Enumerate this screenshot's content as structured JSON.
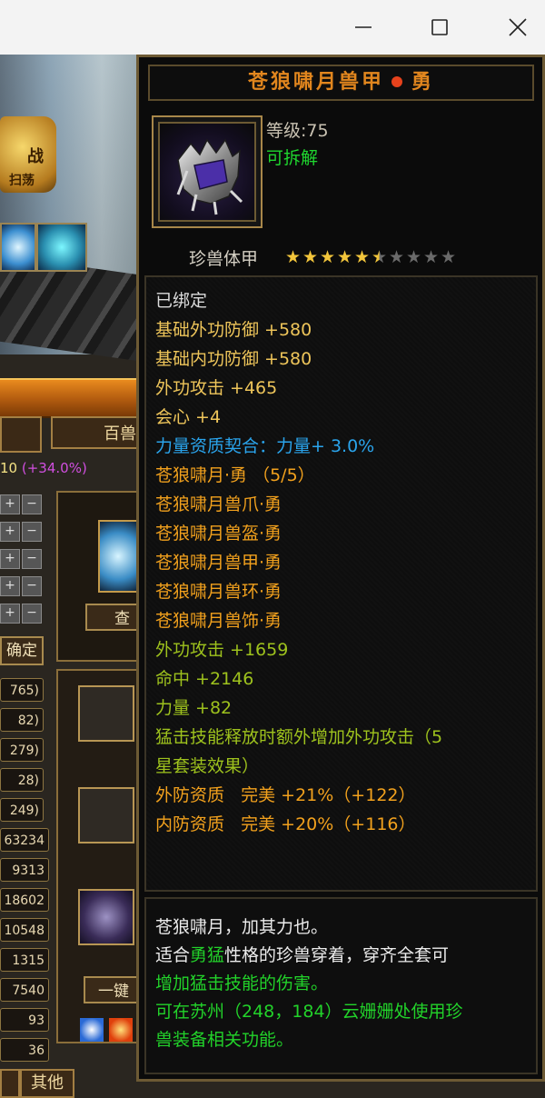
{
  "window": {
    "minimize_icon": "minimize-icon",
    "maximize_icon": "maximize-icon",
    "close_icon": "close-icon"
  },
  "game_bg": {
    "badge_text": "战",
    "badge_subtext": "扫荡",
    "tab_label": "百兽",
    "value_text": "10",
    "value_pct": "(+34.0%)",
    "confirm_label": "确定",
    "check_label": "查",
    "stat_values": [
      "765)",
      "82)",
      "279)",
      "28)",
      "249)",
      "63234",
      "9313",
      "18602",
      "10548",
      "1315",
      "7540",
      "93",
      "36"
    ],
    "onekey_label": "一键",
    "other_tab": "其他"
  },
  "tooltip": {
    "title": "苍狼啸月兽甲",
    "title_suffix": "勇",
    "level_text": "等级:75",
    "decompose_text": "可拆解",
    "item_type": "珍兽体甲",
    "star_rating": 5.5,
    "star_total": 10,
    "attributes": [
      {
        "text": "已绑定",
        "color": "white"
      },
      {
        "text": "基础外功防御 +580",
        "color": "yellow"
      },
      {
        "text": "基础内功防御 +580",
        "color": "yellow"
      },
      {
        "text": "外功攻击 +465",
        "color": "yellow"
      },
      {
        "text": "会心 +4",
        "color": "yellow"
      },
      {
        "text": "力量资质契合：力量+ 3.0%",
        "color": "blue"
      },
      {
        "text": "苍狼啸月·勇 （5/5）",
        "color": "orange"
      },
      {
        "text": "苍狼啸月兽爪·勇",
        "color": "orange"
      },
      {
        "text": "苍狼啸月兽盔·勇",
        "color": "orange"
      },
      {
        "text": "苍狼啸月兽甲·勇",
        "color": "orange"
      },
      {
        "text": "苍狼啸月兽环·勇",
        "color": "orange"
      },
      {
        "text": "苍狼啸月兽饰·勇",
        "color": "orange"
      },
      {
        "text": "外功攻击 +1659",
        "color": "green"
      },
      {
        "text": "命中 +2146",
        "color": "green"
      },
      {
        "text": "力量 +82",
        "color": "green"
      },
      {
        "text": "猛击技能释放时额外增加外功攻击（5",
        "color": "green"
      },
      {
        "text": "星套装效果）",
        "color": "green"
      },
      {
        "text": "外防资质   完美 +21%（+122）",
        "color": "orange"
      },
      {
        "text": "内防资质   完美 +20%（+116）",
        "color": "orange"
      }
    ],
    "flavor": {
      "line1": "苍狼啸月，加其力也。",
      "line2_prefix": "适合",
      "line2_highlight": "勇猛",
      "line2_suffix": "性格的珍兽穿着，穿齐全套可",
      "line3": "增加猛击技能的伤害。",
      "line4": "可在苏州（248，184）云姗姗处使用珍",
      "line5": "兽装备相关功能。"
    }
  },
  "colors": {
    "title": "#e1861e",
    "white": "#dcdcdc",
    "yellow": "#eec55a",
    "blue": "#2aa4ec",
    "orange": "#f2a11d",
    "green": "#9ec21d",
    "highlight_green": "#22d22a"
  }
}
